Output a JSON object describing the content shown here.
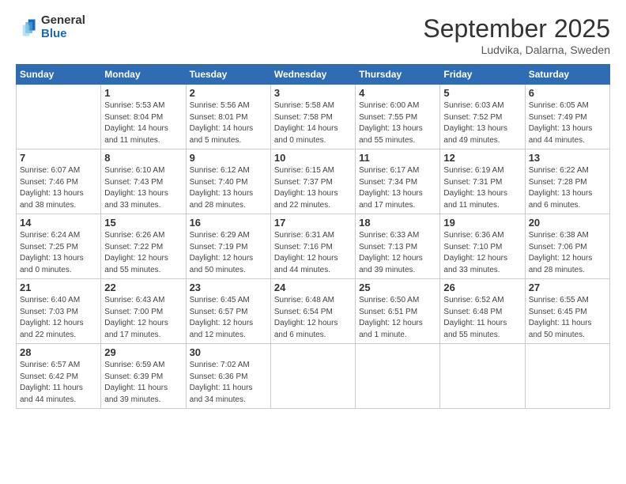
{
  "header": {
    "logo_general": "General",
    "logo_blue": "Blue",
    "month_title": "September 2025",
    "location": "Ludvika, Dalarna, Sweden"
  },
  "weekdays": [
    "Sunday",
    "Monday",
    "Tuesday",
    "Wednesday",
    "Thursday",
    "Friday",
    "Saturday"
  ],
  "weeks": [
    [
      {
        "day": "",
        "info": ""
      },
      {
        "day": "1",
        "info": "Sunrise: 5:53 AM\nSunset: 8:04 PM\nDaylight: 14 hours\nand 11 minutes."
      },
      {
        "day": "2",
        "info": "Sunrise: 5:56 AM\nSunset: 8:01 PM\nDaylight: 14 hours\nand 5 minutes."
      },
      {
        "day": "3",
        "info": "Sunrise: 5:58 AM\nSunset: 7:58 PM\nDaylight: 14 hours\nand 0 minutes."
      },
      {
        "day": "4",
        "info": "Sunrise: 6:00 AM\nSunset: 7:55 PM\nDaylight: 13 hours\nand 55 minutes."
      },
      {
        "day": "5",
        "info": "Sunrise: 6:03 AM\nSunset: 7:52 PM\nDaylight: 13 hours\nand 49 minutes."
      },
      {
        "day": "6",
        "info": "Sunrise: 6:05 AM\nSunset: 7:49 PM\nDaylight: 13 hours\nand 44 minutes."
      }
    ],
    [
      {
        "day": "7",
        "info": "Sunrise: 6:07 AM\nSunset: 7:46 PM\nDaylight: 13 hours\nand 38 minutes."
      },
      {
        "day": "8",
        "info": "Sunrise: 6:10 AM\nSunset: 7:43 PM\nDaylight: 13 hours\nand 33 minutes."
      },
      {
        "day": "9",
        "info": "Sunrise: 6:12 AM\nSunset: 7:40 PM\nDaylight: 13 hours\nand 28 minutes."
      },
      {
        "day": "10",
        "info": "Sunrise: 6:15 AM\nSunset: 7:37 PM\nDaylight: 13 hours\nand 22 minutes."
      },
      {
        "day": "11",
        "info": "Sunrise: 6:17 AM\nSunset: 7:34 PM\nDaylight: 13 hours\nand 17 minutes."
      },
      {
        "day": "12",
        "info": "Sunrise: 6:19 AM\nSunset: 7:31 PM\nDaylight: 13 hours\nand 11 minutes."
      },
      {
        "day": "13",
        "info": "Sunrise: 6:22 AM\nSunset: 7:28 PM\nDaylight: 13 hours\nand 6 minutes."
      }
    ],
    [
      {
        "day": "14",
        "info": "Sunrise: 6:24 AM\nSunset: 7:25 PM\nDaylight: 13 hours\nand 0 minutes."
      },
      {
        "day": "15",
        "info": "Sunrise: 6:26 AM\nSunset: 7:22 PM\nDaylight: 12 hours\nand 55 minutes."
      },
      {
        "day": "16",
        "info": "Sunrise: 6:29 AM\nSunset: 7:19 PM\nDaylight: 12 hours\nand 50 minutes."
      },
      {
        "day": "17",
        "info": "Sunrise: 6:31 AM\nSunset: 7:16 PM\nDaylight: 12 hours\nand 44 minutes."
      },
      {
        "day": "18",
        "info": "Sunrise: 6:33 AM\nSunset: 7:13 PM\nDaylight: 12 hours\nand 39 minutes."
      },
      {
        "day": "19",
        "info": "Sunrise: 6:36 AM\nSunset: 7:10 PM\nDaylight: 12 hours\nand 33 minutes."
      },
      {
        "day": "20",
        "info": "Sunrise: 6:38 AM\nSunset: 7:06 PM\nDaylight: 12 hours\nand 28 minutes."
      }
    ],
    [
      {
        "day": "21",
        "info": "Sunrise: 6:40 AM\nSunset: 7:03 PM\nDaylight: 12 hours\nand 22 minutes."
      },
      {
        "day": "22",
        "info": "Sunrise: 6:43 AM\nSunset: 7:00 PM\nDaylight: 12 hours\nand 17 minutes."
      },
      {
        "day": "23",
        "info": "Sunrise: 6:45 AM\nSunset: 6:57 PM\nDaylight: 12 hours\nand 12 minutes."
      },
      {
        "day": "24",
        "info": "Sunrise: 6:48 AM\nSunset: 6:54 PM\nDaylight: 12 hours\nand 6 minutes."
      },
      {
        "day": "25",
        "info": "Sunrise: 6:50 AM\nSunset: 6:51 PM\nDaylight: 12 hours\nand 1 minute."
      },
      {
        "day": "26",
        "info": "Sunrise: 6:52 AM\nSunset: 6:48 PM\nDaylight: 11 hours\nand 55 minutes."
      },
      {
        "day": "27",
        "info": "Sunrise: 6:55 AM\nSunset: 6:45 PM\nDaylight: 11 hours\nand 50 minutes."
      }
    ],
    [
      {
        "day": "28",
        "info": "Sunrise: 6:57 AM\nSunset: 6:42 PM\nDaylight: 11 hours\nand 44 minutes."
      },
      {
        "day": "29",
        "info": "Sunrise: 6:59 AM\nSunset: 6:39 PM\nDaylight: 11 hours\nand 39 minutes."
      },
      {
        "day": "30",
        "info": "Sunrise: 7:02 AM\nSunset: 6:36 PM\nDaylight: 11 hours\nand 34 minutes."
      },
      {
        "day": "",
        "info": ""
      },
      {
        "day": "",
        "info": ""
      },
      {
        "day": "",
        "info": ""
      },
      {
        "day": "",
        "info": ""
      }
    ]
  ]
}
